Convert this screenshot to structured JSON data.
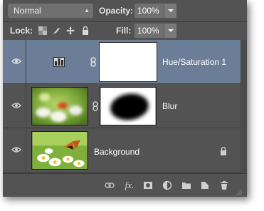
{
  "blend_mode": {
    "value": "Normal"
  },
  "opacity": {
    "label": "Opacity:",
    "value": "100%"
  },
  "lock": {
    "label": "Lock:"
  },
  "fill": {
    "label": "Fill:",
    "value": "100%"
  },
  "layers": [
    {
      "name": "Hue/Saturation 1",
      "selected": true,
      "type": "adjustment"
    },
    {
      "name": "Blur",
      "selected": false,
      "type": "masked-image"
    },
    {
      "name": "Background",
      "selected": false,
      "type": "background",
      "locked": true
    }
  ],
  "bottom_icons": [
    "link-icon",
    "fx-icon",
    "mask-icon",
    "adjustment-icon",
    "folder-icon",
    "new-layer-icon",
    "trash-icon"
  ],
  "bottom_labels": {
    "fx": "fx."
  },
  "colors": {
    "panel": "#535353",
    "selected_row": "#6c7e97",
    "field": "#707070"
  }
}
